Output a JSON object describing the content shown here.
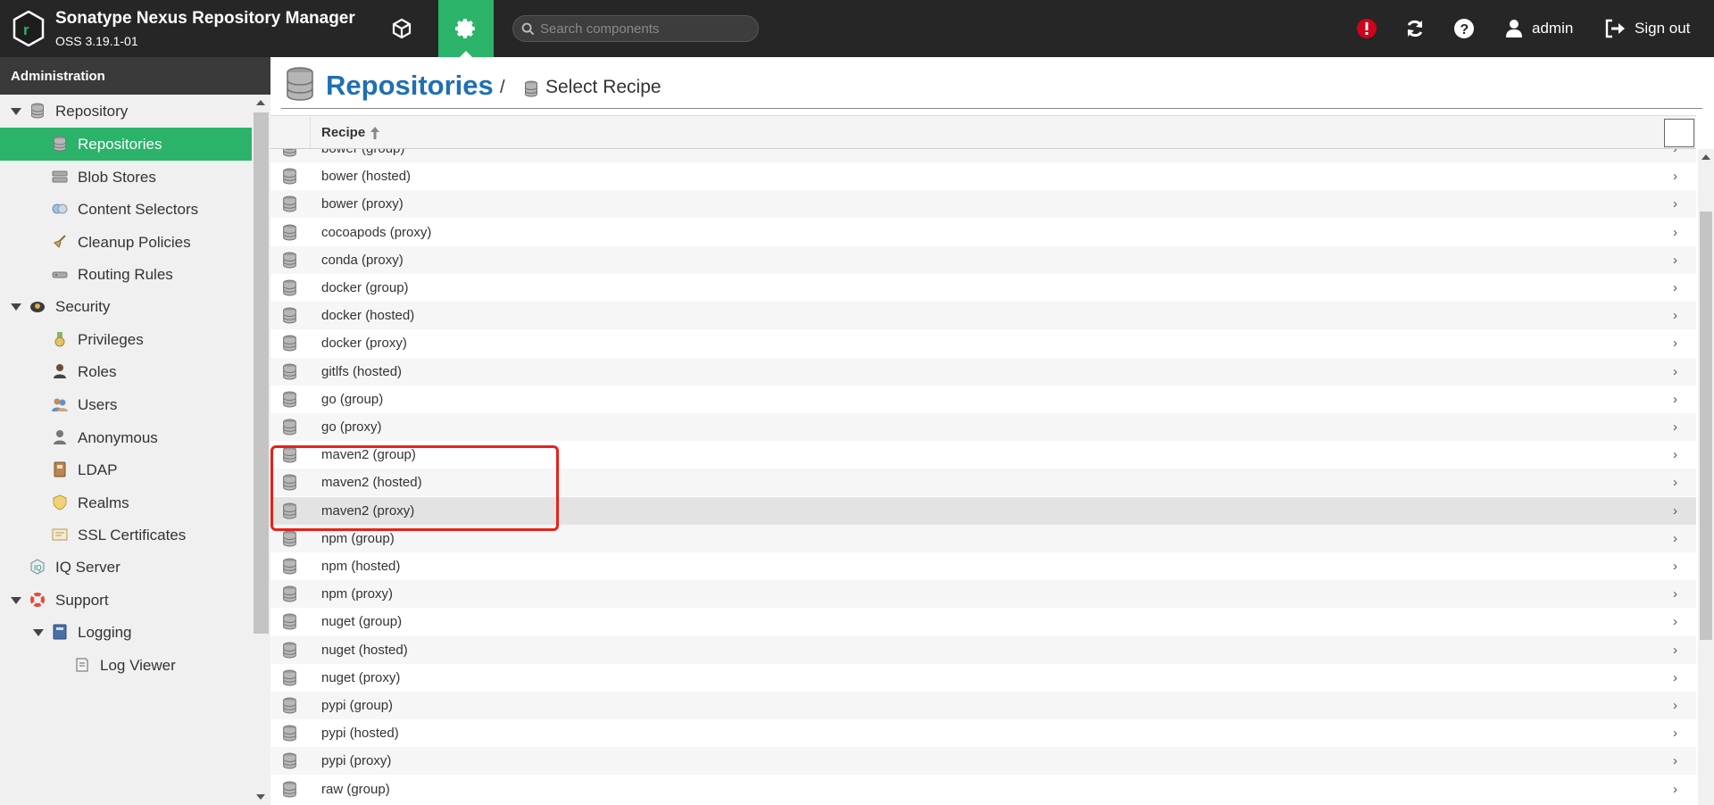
{
  "header": {
    "title": "Sonatype Nexus Repository Manager",
    "version": "OSS 3.19.1-01",
    "search_placeholder": "Search components",
    "user": "admin",
    "signout": "Sign out"
  },
  "sidebar": {
    "title": "Administration",
    "items": [
      {
        "label": "Repository",
        "icon": "database-icon",
        "level": 0,
        "expanded": true
      },
      {
        "label": "Repositories",
        "icon": "database-icon",
        "level": 1,
        "active": true
      },
      {
        "label": "Blob Stores",
        "icon": "server-icon",
        "level": 1
      },
      {
        "label": "Content Selectors",
        "icon": "content-selector-icon",
        "level": 1
      },
      {
        "label": "Cleanup Policies",
        "icon": "broom-icon",
        "level": 1
      },
      {
        "label": "Routing Rules",
        "icon": "router-icon",
        "level": 1
      },
      {
        "label": "Security",
        "icon": "badge-icon",
        "level": 0,
        "expanded": true
      },
      {
        "label": "Privileges",
        "icon": "medal-icon",
        "level": 1
      },
      {
        "label": "Roles",
        "icon": "role-icon",
        "level": 1
      },
      {
        "label": "Users",
        "icon": "users-icon",
        "level": 1
      },
      {
        "label": "Anonymous",
        "icon": "anonymous-icon",
        "level": 1
      },
      {
        "label": "LDAP",
        "icon": "address-book-icon",
        "level": 1
      },
      {
        "label": "Realms",
        "icon": "shield-icon",
        "level": 1
      },
      {
        "label": "SSL Certificates",
        "icon": "certificate-icon",
        "level": 1
      },
      {
        "label": "IQ Server",
        "icon": "iq-icon",
        "level": 0
      },
      {
        "label": "Support",
        "icon": "lifebuoy-icon",
        "level": 0,
        "expanded": true
      },
      {
        "label": "Logging",
        "icon": "book-icon",
        "level": 1,
        "expanded": true
      },
      {
        "label": "Log Viewer",
        "icon": "log-icon",
        "level": 2
      }
    ]
  },
  "breadcrumb": {
    "title": "Repositories",
    "separator": "/",
    "current": "Select Recipe"
  },
  "grid": {
    "column_header": "Recipe",
    "rows": [
      "bower (group)",
      "bower (hosted)",
      "bower (proxy)",
      "cocoapods (proxy)",
      "conda (proxy)",
      "docker (group)",
      "docker (hosted)",
      "docker (proxy)",
      "gitlfs (hosted)",
      "go (group)",
      "go (proxy)",
      "maven2 (group)",
      "maven2 (hosted)",
      "maven2 (proxy)",
      "npm (group)",
      "npm (hosted)",
      "npm (proxy)",
      "nuget (group)",
      "nuget (hosted)",
      "nuget (proxy)",
      "pypi (group)",
      "pypi (hosted)",
      "pypi (proxy)",
      "raw (group)"
    ],
    "selected": "maven2 (proxy)",
    "chevron": "›"
  },
  "colors": {
    "topbar": "#262626",
    "accent_green": "#2bb36a",
    "title_blue": "#1f6fb5",
    "highlight_red": "#e8211b"
  }
}
